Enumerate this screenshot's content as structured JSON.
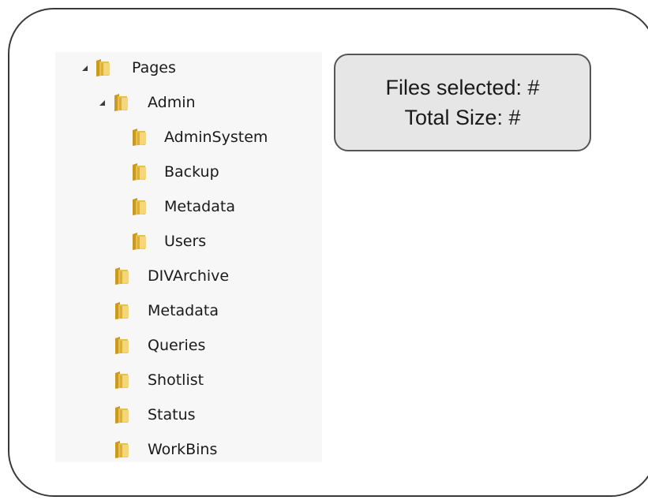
{
  "tree": {
    "root": {
      "label": "Pages",
      "expanded": true,
      "icon": "folder-icon"
    },
    "admin": {
      "label": "Admin",
      "expanded": true,
      "icon": "folder-icon"
    },
    "admin_children": [
      "AdminSystem",
      "Backup",
      "Metadata",
      "Users"
    ],
    "pages_children": [
      "DIVArchive",
      "Metadata",
      "Queries",
      "Shotlist",
      "Status",
      "WorkBins"
    ]
  },
  "info": {
    "files_selected": "Files selected: #",
    "total_size": "Total Size: #"
  },
  "colors": {
    "frame_border": "#3a3a3a",
    "info_background": "#e6e6e6",
    "tree_background": "#f7f7f7",
    "folder_yellow": "#e8c04a"
  }
}
